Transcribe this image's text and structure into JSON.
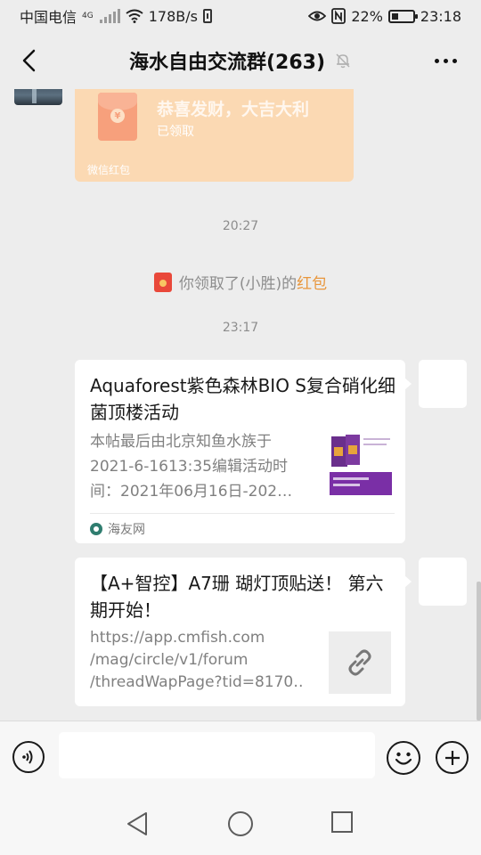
{
  "status_bar": {
    "carrier": "中国电信",
    "network_type": "4G",
    "speed": "178B/s",
    "battery_percent": "22%",
    "battery_level": 0.22,
    "time": "23:18"
  },
  "header": {
    "title": "海水自由交流群(263)",
    "muted": true
  },
  "messages": {
    "red_packet": {
      "title": "恭喜发财，大吉大利",
      "status": "已领取",
      "label": "微信红包"
    },
    "time_1": "20:27",
    "system": {
      "prefix": "你领取了(小胜)的",
      "link": "红包"
    },
    "time_2": "23:17",
    "link_card_1": {
      "title": "Aquaforest紫色森林BIO S复合硝化细菌顶楼活动",
      "desc_lines": [
        "本帖最后由北京知鱼水族于",
        "2021-6-1613:35编辑活动时",
        "间：2021年06月16日-202…"
      ],
      "source": "海友网"
    },
    "link_card_2": {
      "title": "【A+智控】A7珊 瑚灯顶贴送！ 第六期开始！",
      "desc_lines": [
        "https://app.cmfish.com",
        "/mag/circle/v1/forum",
        "/threadWapPage?tid=8170…"
      ]
    }
  },
  "input_bar": {
    "placeholder": ""
  },
  "colors": {
    "background": "#ededed",
    "red_packet": "#fbd9b3",
    "link_accent": "#e8963c"
  },
  "icons": [
    "back-icon",
    "mute-bell-icon",
    "more-icon",
    "voice-icon",
    "emoji-icon",
    "plus-icon",
    "link-icon",
    "nav-back-icon",
    "nav-home-icon",
    "nav-recent-icon"
  ]
}
